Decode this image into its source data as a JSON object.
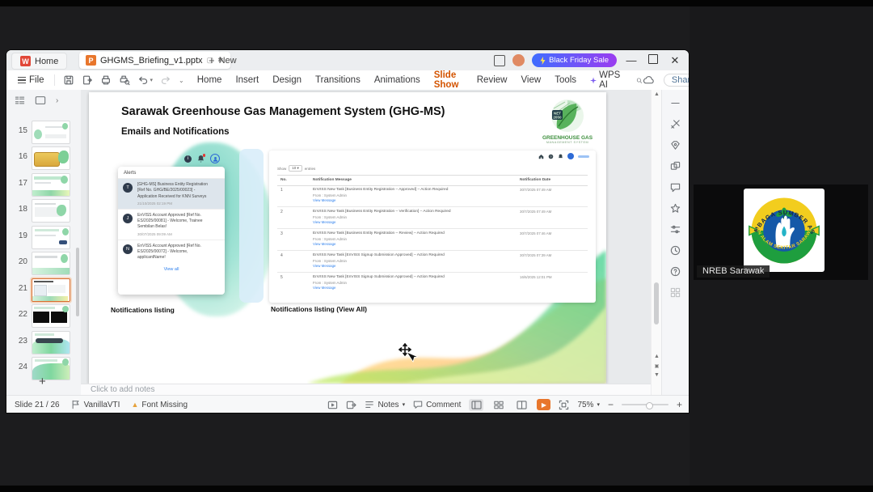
{
  "colors": {
    "accent_orange": "#d35400",
    "promo_gradient_start": "#3f6dff",
    "promo_gradient_end": "#9b3df0",
    "link_blue": "#2f80ed",
    "logo_green": "#3d8f3d",
    "nreb_yellow": "#f2cd1e",
    "nreb_green": "#1e9e3e",
    "nreb_blue": "#1559a8"
  },
  "app": {
    "titlebar": {
      "home_tab": "Home",
      "doc_tab": "GHGMS_Briefing_v1.pptx",
      "new_tab": "New",
      "promo": "Black Friday Sale"
    },
    "menubar": {
      "file": "File",
      "items": [
        "Home",
        "Insert",
        "Design",
        "Transitions",
        "Animations",
        "Slide Show",
        "Review",
        "View",
        "Tools",
        "WPS AI"
      ],
      "share": "Share"
    },
    "thumbs": [
      "15",
      "16",
      "17",
      "18",
      "19",
      "20",
      "21",
      "22",
      "23",
      "24"
    ],
    "notes_placeholder": "Click to add notes",
    "statusbar": {
      "slide_indicator": "Slide 21 / 26",
      "theme_name": "VanillaVTI",
      "font_missing": "Font Missing",
      "notes": "Notes",
      "comment": "Comment",
      "zoom_level": "75%"
    }
  },
  "slide": {
    "title": "Sarawak Greenhouse Gas Management System (GHG-MS)",
    "subtitle": "Emails and Notifications",
    "logo": {
      "badge_line1": "NET",
      "badge_line2": "2050",
      "name_line1": "GREENHOUSE GAS",
      "name_line2": "MANAGEMENT SYSTEM"
    },
    "alerts": {
      "header": "Alerts",
      "items": [
        {
          "initial": "T",
          "text": "[GHG-MS] Business Entity Registration [Ref No. GHG/BE/2025/00023] - Application Received for KNN Surveys",
          "time": "21/10/2025 02:19 PM"
        },
        {
          "initial": "J",
          "text": "EnVISS Account Approved [Ref No. ES/2025/00081] - Welcome, Trainee Sembilan Belas!",
          "time": "30/07/2025 09:09 AM"
        },
        {
          "initial": "N",
          "text": "EnVISS Account Approved [Ref No. ES/2025/00072] - Welcome, applicantName!",
          "time": ""
        }
      ],
      "view_all": "View all"
    },
    "notif_table": {
      "show_label": "Show",
      "page_size": "10",
      "entries_label": "entries",
      "col_no": "No.",
      "col_message": "Notification Message",
      "col_date": "Notification Date",
      "from_label": "From : System Admin",
      "view_link": "View Message",
      "rows": [
        {
          "no": "1",
          "message": "EnVISS New Task [Business Entity Registration – Approved] – Action Required",
          "date": "30/7/2025 07:49 AM"
        },
        {
          "no": "2",
          "message": "EnVISS New Task [Business Entity Registration – Verification] – Action Required",
          "date": "30/7/2025 07:49 AM"
        },
        {
          "no": "3",
          "message": "EnVISS New Task [Business Entity Registration – Review] – Action Required",
          "date": "30/7/2025 07:46 AM"
        },
        {
          "no": "4",
          "message": "EnVISS New Task [EnVISS Signup Submission Approved] – Action Required",
          "date": "30/7/2025 07:39 AM"
        },
        {
          "no": "5",
          "message": "EnVISS New Task [EnVISS Signup Submission Approved] – Action Required",
          "date": "16/6/2025 12:01 PM"
        }
      ]
    },
    "caption_left": "Notifications listing",
    "caption_right": "Notifications listing (View All)"
  },
  "participant": {
    "name": "NREB Sarawak",
    "logo_top_text": "LEMBAGA SUMBER ASLI",
    "logo_bottom_text": "DAN ALAM SEKITAR SARAWAK"
  }
}
